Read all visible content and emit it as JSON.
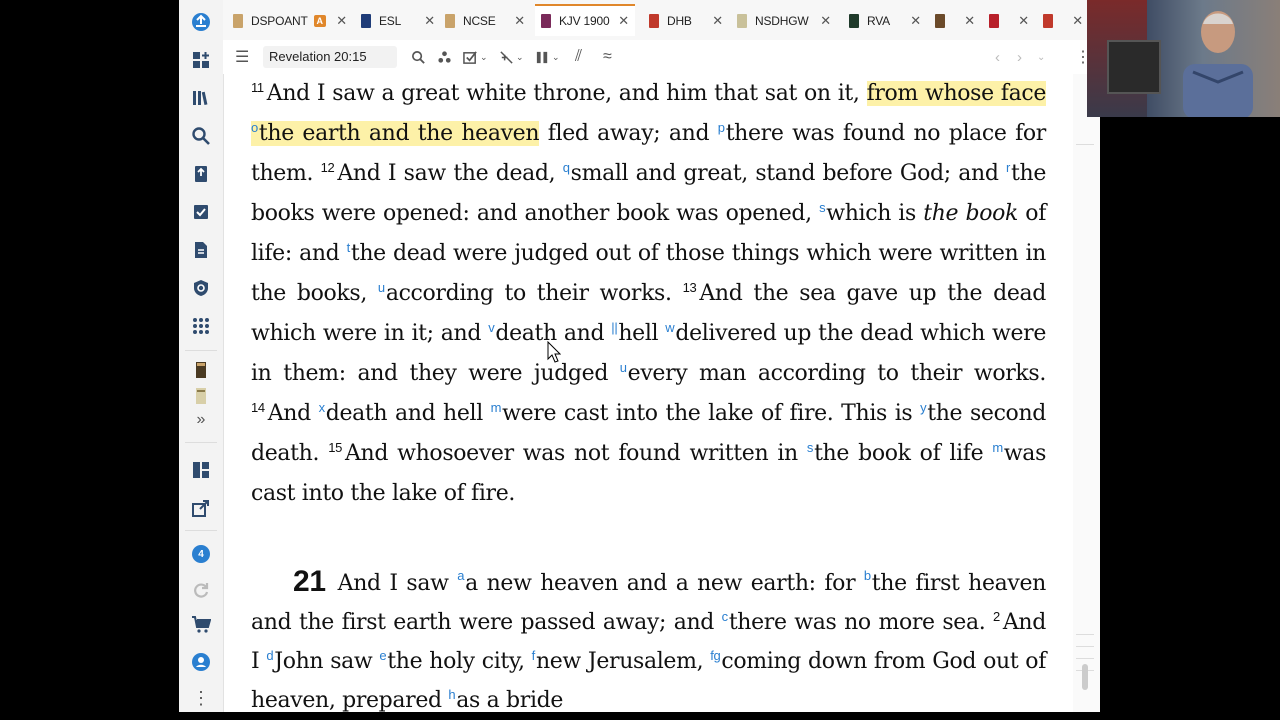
{
  "tabs": [
    {
      "label": "DSPOANT",
      "color": "#c9a36a",
      "badge": "A"
    },
    {
      "label": "ESL",
      "color": "#1f3c78"
    },
    {
      "label": "NCSE",
      "color": "#c9a36a"
    },
    {
      "label": "KJV 1900",
      "color": "#7a2a5a",
      "active": true
    },
    {
      "label": "DHB",
      "color": "#c0392b"
    },
    {
      "label": "NSDHGW",
      "color": "#c9c19a"
    },
    {
      "label": "RVA",
      "color": "#1f3a2a"
    },
    {
      "label": "",
      "color": "#6b4a2a"
    },
    {
      "label": "",
      "color": "#b8202a"
    },
    {
      "label": "",
      "color": "#c0392b"
    }
  ],
  "toolbar": {
    "reference": "Revelation 20:15"
  },
  "rail": {
    "badge_count": "4"
  },
  "text": {
    "v11_num": "11",
    "v11_a": "And I saw a great white throne, and him that sat on it, ",
    "v11_hl1": "from whose face ",
    "fn_o": "o",
    "v11_hl2": "the earth and the heaven",
    "v11_b": " fled away; and ",
    "fn_p": "p",
    "v11_c": "there was found no place for them. ",
    "v12_num": "12",
    "v12_a": "And I saw the dead, ",
    "fn_q": "q",
    "v12_b": "small and great, stand before God; and ",
    "fn_r": "r",
    "v12_c": "the books were opened: and another book was opened, ",
    "fn_s": "s",
    "v12_d": "which is ",
    "v12_it": "the book",
    "v12_e": " of life: and ",
    "fn_t": "t",
    "v12_f": "the dead were judged out of those things which were written in the books, ",
    "fn_u": "u",
    "v12_g": "according to their works. ",
    "v13_num": "13",
    "v13_a": "And the sea gave up the dead which were in it; and ",
    "fn_v": "v",
    "v13_b": "death and ",
    "fn_bar": "||",
    "v13_c": "hell ",
    "fn_w": "w",
    "v13_d": "delivered up the dead which were in them: and they were judged ",
    "fn_u2": "u",
    "v13_e": "every man according to their works. ",
    "v14_num": "14",
    "v14_a": "And ",
    "fn_x": "x",
    "v14_b": "death and hell ",
    "fn_m": "m",
    "v14_c": "were cast into the lake of fire. This is ",
    "fn_y": "y",
    "v14_d": "the second death. ",
    "v15_num": "15",
    "v15_a": "And whosoever was not found written in ",
    "fn_s2": "s",
    "v15_b": "the book of life ",
    "fn_m2": "m",
    "v15_c": "was cast into the lake of fire.",
    "ch21": "21",
    "c1_a": "And I saw ",
    "fn_a": "a",
    "c1_b": "a new heaven and a new earth: for ",
    "fn_b": "b",
    "c1_c": "the first heaven and the first earth were passed away; and ",
    "fn_c": "c",
    "c1_d": "there was no more sea. ",
    "v2_num": "2",
    "v2_a": "And I ",
    "fn_d": "d",
    "v2_b": "John saw ",
    "fn_e": "e",
    "v2_c": "the holy city, ",
    "fn_f": "f",
    "v2_d": "new Jerusalem, ",
    "fn_fg": "fg",
    "v2_e": "coming down from God out of heaven, prepared ",
    "fn_h": "h",
    "v2_f": "as a bride"
  }
}
